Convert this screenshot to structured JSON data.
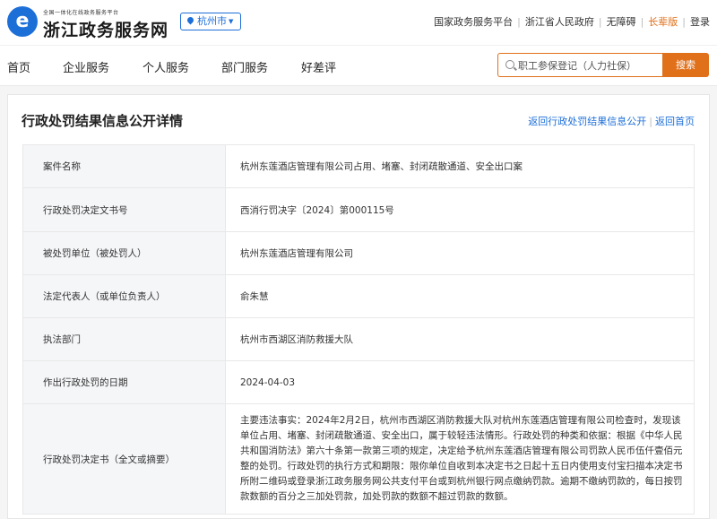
{
  "header": {
    "logo_glyph": "e",
    "brand_small": "全国一体化在线政务服务平台",
    "brand_title": "浙江政务服务网",
    "city": "杭州市",
    "links": [
      "国家政务服务平台",
      "浙江省人民政府",
      "无障碍",
      "长辈版",
      "登录"
    ],
    "accent_color": "#1d6fd8",
    "highlight_color": "#e0701a"
  },
  "nav": {
    "items": [
      "首页",
      "企业服务",
      "个人服务",
      "部门服务",
      "好差评"
    ]
  },
  "search": {
    "placeholder": "职工参保登记（人力社保）",
    "button_label": "搜索"
  },
  "panel": {
    "title": "行政处罚结果信息公开详情",
    "link_back_list": "返回行政处罚结果信息公开",
    "link_home": "返回首页"
  },
  "rows": [
    {
      "label": "案件名称",
      "value": "杭州东莲酒店管理有限公司占用、堵塞、封闭疏散通道、安全出口案"
    },
    {
      "label": "行政处罚决定文书号",
      "value": "西消行罚决字〔2024〕第000115号"
    },
    {
      "label": "被处罚单位（被处罚人）",
      "value": "杭州东莲酒店管理有限公司"
    },
    {
      "label": "法定代表人（或单位负责人）",
      "value": "俞朱慧"
    },
    {
      "label": "执法部门",
      "value": "杭州市西湖区消防救援大队"
    },
    {
      "label": "作出行政处罚的日期",
      "value": "2024-04-03"
    },
    {
      "label": "行政处罚决定书（全文或摘要）",
      "value": "主要违法事实：2024年2月2日，杭州市西湖区消防救援大队对杭州东莲酒店管理有限公司检查时，发现该单位占用、堵塞、封闭疏散通道、安全出口，属于较轻违法情形。行政处罚的种类和依据：根据《中华人民共和国消防法》第六十条第一款第三项的规定，决定给予杭州东莲酒店管理有限公司罚款人民币伍仟壹佰元整的处罚。行政处罚的执行方式和期限：限你单位自收到本决定书之日起十五日内使用支付宝扫描本决定书所附二维码或登录浙江政务服务网公共支付平台或到杭州银行网点缴纳罚款。逾期不缴纳罚款的，每日按罚款数额的百分之三加处罚款，加处罚款的数额不超过罚款的数额。"
    }
  ]
}
